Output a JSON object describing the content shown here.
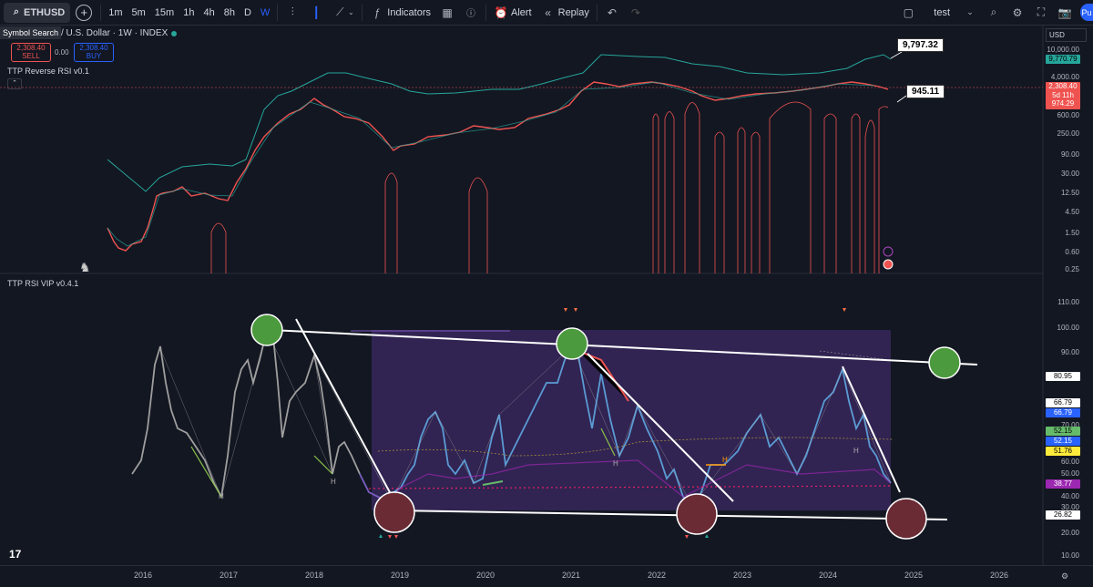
{
  "toolbar": {
    "symbol": "ETHUSD",
    "intervals": [
      "1m",
      "5m",
      "15m",
      "1h",
      "4h",
      "8h",
      "D",
      "W"
    ],
    "active_interval": "W",
    "indicators_label": "Indicators",
    "alert_label": "Alert",
    "replay_label": "Replay",
    "layout_name": "test",
    "publish_label": "Pu"
  },
  "tooltip": {
    "symbol_search": "Symbol Search"
  },
  "legend": {
    "title": "/ U.S. Dollar · 1W · INDEX",
    "sell_price": "2,308.40",
    "sell_label": "SELL",
    "spread": "0.00",
    "buy_price": "2,308.40",
    "buy_label": "BUY",
    "indicator1": "TTP Reverse RSI v0.1",
    "indicator2": "TTP RSI VIP v0.4.1"
  },
  "price_axis": {
    "currency": "USD",
    "labels": [
      "10,000.00",
      "4,000.00",
      "600.00",
      "250.00",
      "90.00",
      "30.00",
      "12.50",
      "4.50",
      "1.50",
      "0.60",
      "0.25"
    ],
    "tag_green": "9,770.79",
    "tag_price": "2,308.40",
    "tag_countdown": "5d 11h",
    "tag_red": "974.29"
  },
  "rsi_axis": {
    "labels": [
      "110.00",
      "100.00",
      "90.00",
      "70.00",
      "60.00",
      "50.00",
      "40.00",
      "30.00",
      "20.00",
      "10.00"
    ],
    "tag_a": "80.95",
    "tag_b": "66.79",
    "tag_c": "66.79",
    "tag_d": "52.15",
    "tag_e": "52.15",
    "tag_f": "51.76",
    "tag_g": "38.77",
    "tag_h": "26.82"
  },
  "callouts": {
    "upper": "9,797.32",
    "lower": "945.11"
  },
  "x_axis": {
    "years": [
      "2016",
      "2017",
      "2018",
      "2019",
      "2020",
      "2021",
      "2022",
      "2023",
      "2024",
      "2025",
      "2026"
    ]
  },
  "pivot_label": "H",
  "colors": {
    "bg": "#131722",
    "green_line": "#26a69a",
    "red_line": "#ef5350",
    "rsi_blue": "#5b9bd5",
    "rsi_purple": "#9c27b0",
    "box": "#4a2f7a"
  }
}
